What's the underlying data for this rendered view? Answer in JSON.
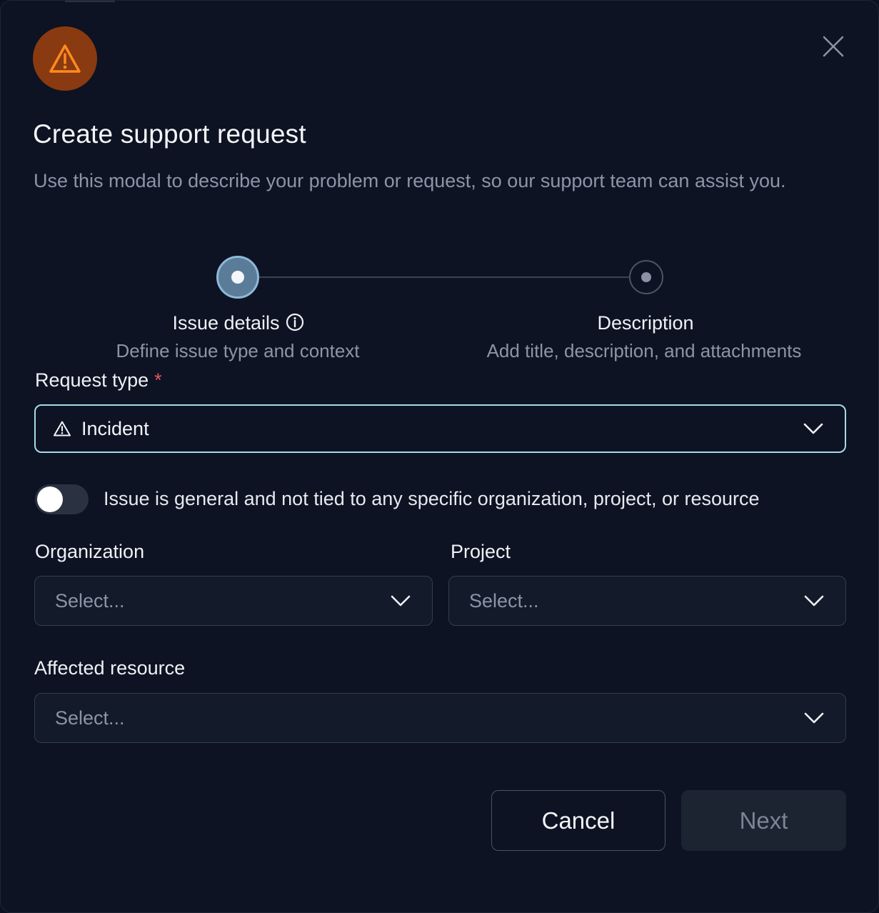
{
  "modal": {
    "title": "Create support request",
    "subtitle": "Use this modal to describe your problem or request, so our support team can assist you.",
    "badge_icon": "warning-triangle-icon",
    "accent_color": "#8a3a10"
  },
  "stepper": {
    "steps": [
      {
        "label": "Issue details",
        "description": "Define issue type and context",
        "state": "active"
      },
      {
        "label": "Description",
        "description": "Add title, description, and attachments",
        "state": "upcoming"
      }
    ]
  },
  "form": {
    "request_type": {
      "label": "Request type",
      "required_mark": "*",
      "value": "Incident",
      "icon": "warning-triangle-icon"
    },
    "general_toggle": {
      "label": "Issue is general and not tied to any specific organization, project, or resource",
      "on": false
    },
    "organization": {
      "label": "Organization",
      "placeholder": "Select..."
    },
    "project": {
      "label": "Project",
      "placeholder": "Select..."
    },
    "affected_resource": {
      "label": "Affected resource",
      "placeholder": "Select..."
    }
  },
  "footer": {
    "cancel_label": "Cancel",
    "next_label": "Next"
  }
}
